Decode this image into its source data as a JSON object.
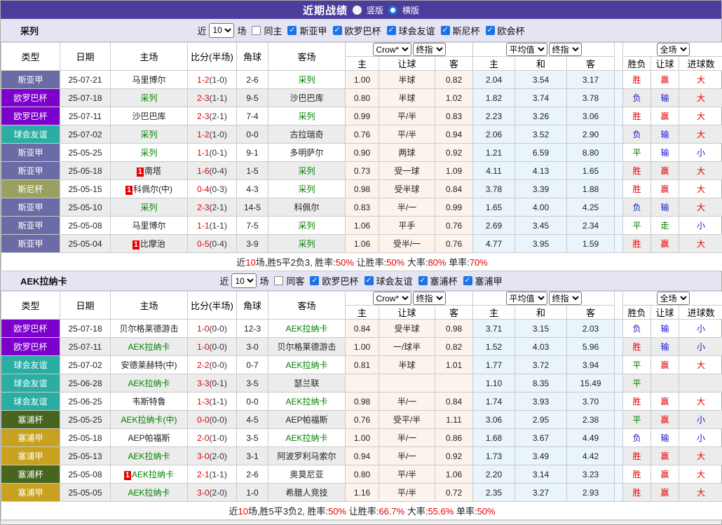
{
  "title_bar": {
    "title": "近期战绩",
    "vertical_label": "竖版",
    "horizontal_label": "横版",
    "vertical_checked": false,
    "horizontal_checked": true
  },
  "colors": {
    "titlebar_bg": "#4b3d9c",
    "filterbar_bg": "#e4e4f3",
    "score_red": "#e60000",
    "focus_team_green": "#008000",
    "league_colors": {
      "斯亚甲": "#6b6ba5",
      "欧罗巴杯": "#7d00cc",
      "球会友谊": "#2aada3",
      "斯尼杯": "#9aa05e",
      "塞浦杯": "#47651d",
      "塞浦甲": "#c7a11f",
      "欧会杯": "#7d00cc"
    },
    "result_class": {
      "胜": "r",
      "赢": "r",
      "大": "r",
      "负": "b",
      "输": "b",
      "小": "b",
      "平": "g",
      "走": "g"
    }
  },
  "tables": [
    {
      "team": "采列",
      "filter": {
        "near_label": "近",
        "count": "10",
        "games_label": "场",
        "same_label": "同主",
        "same_checked": false,
        "leagues": [
          {
            "label": "斯亚甲",
            "checked": true
          },
          {
            "label": "欧罗巴杯",
            "checked": true
          },
          {
            "label": "球会友谊",
            "checked": true
          },
          {
            "label": "斯尼杯",
            "checked": true
          },
          {
            "label": "欧会杯",
            "checked": true
          }
        ]
      },
      "header": {
        "type": "类型",
        "date": "日期",
        "home": "主场",
        "score": "比分(半场)",
        "corner": "角球",
        "away": "客场",
        "odds1_select": "Crow*",
        "odds1_select2": "终指",
        "odds1_cols": [
          "主",
          "让球",
          "客"
        ],
        "odds2_select": "平均值",
        "odds2_select2": "终指",
        "odds2_cols": [
          "主",
          "和",
          "客"
        ],
        "result_select": "全场",
        "result_cols": [
          "胜负",
          "让球",
          "进球数"
        ]
      },
      "rows": [
        {
          "type": "斯亚甲",
          "date": "25-07-21",
          "home": "马里博尔",
          "home_focus": false,
          "home_badge": "",
          "score": "1-2",
          "half": "(1-0)",
          "corner": "2-6",
          "away": "采列",
          "away_focus": true,
          "odds": [
            "1.00",
            "半球",
            "0.82"
          ],
          "avg": [
            "2.04",
            "3.54",
            "3.17"
          ],
          "results": [
            "胜",
            "赢",
            "大"
          ]
        },
        {
          "type": "欧罗巴杯",
          "date": "25-07-18",
          "home": "采列",
          "home_focus": true,
          "home_badge": "",
          "score": "2-3",
          "half": "(1-1)",
          "corner": "9-5",
          "away": "沙巴巴库",
          "away_focus": false,
          "odds": [
            "0.80",
            "半球",
            "1.02"
          ],
          "avg": [
            "1.82",
            "3.74",
            "3.78"
          ],
          "results": [
            "负",
            "输",
            "大"
          ]
        },
        {
          "type": "欧罗巴杯",
          "date": "25-07-11",
          "home": "沙巴巴库",
          "home_focus": false,
          "home_badge": "",
          "score": "2-3",
          "half": "(2-1)",
          "corner": "7-4",
          "away": "采列",
          "away_focus": true,
          "odds": [
            "0.99",
            "平/半",
            "0.83"
          ],
          "avg": [
            "2.23",
            "3.26",
            "3.06"
          ],
          "results": [
            "胜",
            "赢",
            "大"
          ]
        },
        {
          "type": "球会友谊",
          "date": "25-07-02",
          "home": "采列",
          "home_focus": true,
          "home_badge": "",
          "score": "1-2",
          "half": "(1-0)",
          "corner": "0-0",
          "away": "古拉瑞奇",
          "away_focus": false,
          "odds": [
            "0.76",
            "平/半",
            "0.94"
          ],
          "avg": [
            "2.06",
            "3.52",
            "2.90"
          ],
          "results": [
            "负",
            "输",
            "大"
          ]
        },
        {
          "type": "斯亚甲",
          "date": "25-05-25",
          "home": "采列",
          "home_focus": true,
          "home_badge": "",
          "score": "1-1",
          "half": "(0-1)",
          "corner": "9-1",
          "away": "多明萨尔",
          "away_focus": false,
          "odds": [
            "0.90",
            "两球",
            "0.92"
          ],
          "avg": [
            "1.21",
            "6.59",
            "8.80"
          ],
          "results": [
            "平",
            "输",
            "小"
          ]
        },
        {
          "type": "斯亚甲",
          "date": "25-05-18",
          "home": "南塔",
          "home_focus": false,
          "home_badge": "1",
          "score": "1-6",
          "half": "(0-4)",
          "corner": "1-5",
          "away": "采列",
          "away_focus": true,
          "odds": [
            "0.73",
            "受一球",
            "1.09"
          ],
          "avg": [
            "4.11",
            "4.13",
            "1.65"
          ],
          "results": [
            "胜",
            "赢",
            "大"
          ]
        },
        {
          "type": "斯尼杯",
          "date": "25-05-15",
          "home": "科佩尔(中)",
          "home_focus": false,
          "home_badge": "1",
          "score": "0-4",
          "half": "(0-3)",
          "corner": "4-3",
          "away": "采列",
          "away_focus": true,
          "odds": [
            "0.98",
            "受半球",
            "0.84"
          ],
          "avg": [
            "3.78",
            "3.39",
            "1.88"
          ],
          "results": [
            "胜",
            "赢",
            "大"
          ]
        },
        {
          "type": "斯亚甲",
          "date": "25-05-10",
          "home": "采列",
          "home_focus": true,
          "home_badge": "",
          "score": "2-3",
          "half": "(2-1)",
          "corner": "14-5",
          "away": "科佩尔",
          "away_focus": false,
          "odds": [
            "0.83",
            "半/一",
            "0.99"
          ],
          "avg": [
            "1.65",
            "4.00",
            "4.25"
          ],
          "results": [
            "负",
            "输",
            "大"
          ]
        },
        {
          "type": "斯亚甲",
          "date": "25-05-08",
          "home": "马里博尔",
          "home_focus": false,
          "home_badge": "",
          "score": "1-1",
          "half": "(1-1)",
          "corner": "7-5",
          "away": "采列",
          "away_focus": true,
          "odds": [
            "1.06",
            "平手",
            "0.76"
          ],
          "avg": [
            "2.69",
            "3.45",
            "2.34"
          ],
          "results": [
            "平",
            "走",
            "小"
          ]
        },
        {
          "type": "斯亚甲",
          "date": "25-05-04",
          "home": "比摩治",
          "home_focus": false,
          "home_badge": "1",
          "score": "0-5",
          "half": "(0-4)",
          "corner": "3-9",
          "away": "采列",
          "away_focus": true,
          "odds": [
            "1.06",
            "受半/一",
            "0.76"
          ],
          "avg": [
            "4.77",
            "3.95",
            "1.59"
          ],
          "results": [
            "胜",
            "赢",
            "大"
          ]
        }
      ],
      "summary": [
        {
          "text": "近",
          "red": false
        },
        {
          "text": "10",
          "red": true
        },
        {
          "text": "场,胜5平2负3, 胜率:",
          "red": false
        },
        {
          "text": "50%",
          "red": true
        },
        {
          "text": " 让胜率:",
          "red": false
        },
        {
          "text": "50%",
          "red": true
        },
        {
          "text": " 大率:",
          "red": false
        },
        {
          "text": "80%",
          "red": true
        },
        {
          "text": " 单率:",
          "red": false
        },
        {
          "text": "70%",
          "red": true
        }
      ]
    },
    {
      "team": "AEK拉纳卡",
      "filter": {
        "near_label": "近",
        "count": "10",
        "games_label": "场",
        "same_label": "同客",
        "same_checked": false,
        "leagues": [
          {
            "label": "欧罗巴杯",
            "checked": true
          },
          {
            "label": "球会友谊",
            "checked": true
          },
          {
            "label": "塞浦杯",
            "checked": true
          },
          {
            "label": "塞浦甲",
            "checked": true
          }
        ]
      },
      "header": {
        "type": "类型",
        "date": "日期",
        "home": "主场",
        "score": "比分(半场)",
        "corner": "角球",
        "away": "客场",
        "odds1_select": "Crow*",
        "odds1_select2": "终指",
        "odds1_cols": [
          "主",
          "让球",
          "客"
        ],
        "odds2_select": "平均值",
        "odds2_select2": "终指",
        "odds2_cols": [
          "主",
          "和",
          "客"
        ],
        "result_select": "全场",
        "result_cols": [
          "胜负",
          "让球",
          "进球数"
        ]
      },
      "rows": [
        {
          "type": "欧罗巴杯",
          "date": "25-07-18",
          "home": "贝尔格莱德游击",
          "home_focus": false,
          "home_badge": "",
          "score": "1-0",
          "half": "(0-0)",
          "corner": "12-3",
          "away": "AEK拉纳卡",
          "away_focus": true,
          "odds": [
            "0.84",
            "受半球",
            "0.98"
          ],
          "avg": [
            "3.71",
            "3.15",
            "2.03"
          ],
          "results": [
            "负",
            "输",
            "小"
          ]
        },
        {
          "type": "欧罗巴杯",
          "date": "25-07-11",
          "home": "AEK拉纳卡",
          "home_focus": true,
          "home_badge": "",
          "score": "1-0",
          "half": "(0-0)",
          "corner": "3-0",
          "away": "贝尔格莱德游击",
          "away_focus": false,
          "odds": [
            "1.00",
            "一/球半",
            "0.82"
          ],
          "avg": [
            "1.52",
            "4.03",
            "5.96"
          ],
          "results": [
            "胜",
            "输",
            "小"
          ]
        },
        {
          "type": "球会友谊",
          "date": "25-07-02",
          "home": "安德莱赫特(中)",
          "home_focus": false,
          "home_badge": "",
          "score": "2-2",
          "half": "(0-0)",
          "corner": "0-7",
          "away": "AEK拉纳卡",
          "away_focus": true,
          "odds": [
            "0.81",
            "半球",
            "1.01"
          ],
          "avg": [
            "1.77",
            "3.72",
            "3.94"
          ],
          "results": [
            "平",
            "赢",
            "大"
          ]
        },
        {
          "type": "球会友谊",
          "date": "25-06-28",
          "home": "AEK拉纳卡",
          "home_focus": true,
          "home_badge": "",
          "score": "3-3",
          "half": "(0-1)",
          "corner": "3-5",
          "away": "瑟兰联",
          "away_focus": false,
          "odds": [
            "",
            "",
            ""
          ],
          "avg": [
            "1.10",
            "8.35",
            "15.49"
          ],
          "results": [
            "平",
            "",
            ""
          ]
        },
        {
          "type": "球会友谊",
          "date": "25-06-25",
          "home": "韦斯特鲁",
          "home_focus": false,
          "home_badge": "",
          "score": "1-3",
          "half": "(1-1)",
          "corner": "0-0",
          "away": "AEK拉纳卡",
          "away_focus": true,
          "odds": [
            "0.98",
            "半/一",
            "0.84"
          ],
          "avg": [
            "1.74",
            "3.93",
            "3.70"
          ],
          "results": [
            "胜",
            "赢",
            "大"
          ]
        },
        {
          "type": "塞浦杯",
          "date": "25-05-25",
          "home": "AEK拉纳卡(中)",
          "home_focus": true,
          "home_badge": "",
          "score": "0-0",
          "half": "(0-0)",
          "corner": "4-5",
          "away": "AEP帕福斯",
          "away_focus": false,
          "odds": [
            "0.76",
            "受平/半",
            "1.11"
          ],
          "avg": [
            "3.06",
            "2.95",
            "2.38"
          ],
          "results": [
            "平",
            "赢",
            "小"
          ]
        },
        {
          "type": "塞浦甲",
          "date": "25-05-18",
          "home": "AEP帕福斯",
          "home_focus": false,
          "home_badge": "",
          "score": "2-0",
          "half": "(1-0)",
          "corner": "3-5",
          "away": "AEK拉纳卡",
          "away_focus": true,
          "odds": [
            "1.00",
            "半/一",
            "0.86"
          ],
          "avg": [
            "1.68",
            "3.67",
            "4.49"
          ],
          "results": [
            "负",
            "输",
            "小"
          ]
        },
        {
          "type": "塞浦甲",
          "date": "25-05-13",
          "home": "AEK拉纳卡",
          "home_focus": true,
          "home_badge": "",
          "score": "3-0",
          "half": "(2-0)",
          "corner": "3-1",
          "away": "阿波罗利马索尔",
          "away_focus": false,
          "odds": [
            "0.94",
            "半/一",
            "0.92"
          ],
          "avg": [
            "1.73",
            "3.49",
            "4.42"
          ],
          "results": [
            "胜",
            "赢",
            "大"
          ]
        },
        {
          "type": "塞浦杯",
          "date": "25-05-08",
          "home": "AEK拉纳卡",
          "home_focus": true,
          "home_badge": "1",
          "score": "2-1",
          "half": "(1-1)",
          "corner": "2-6",
          "away": "奥莫尼亚",
          "away_focus": false,
          "odds": [
            "0.80",
            "平/半",
            "1.06"
          ],
          "avg": [
            "2.20",
            "3.14",
            "3.23"
          ],
          "results": [
            "胜",
            "赢",
            "大"
          ]
        },
        {
          "type": "塞浦甲",
          "date": "25-05-05",
          "home": "AEK拉纳卡",
          "home_focus": true,
          "home_badge": "",
          "score": "3-0",
          "half": "(2-0)",
          "corner": "1-0",
          "away": "希腊人竞技",
          "away_focus": false,
          "odds": [
            "1.16",
            "平/半",
            "0.72"
          ],
          "avg": [
            "2.35",
            "3.27",
            "2.93"
          ],
          "results": [
            "胜",
            "赢",
            "大"
          ]
        }
      ],
      "summary": [
        {
          "text": "近",
          "red": false
        },
        {
          "text": "10",
          "red": true
        },
        {
          "text": "场,胜5平3负2, 胜率:",
          "red": false
        },
        {
          "text": "50%",
          "red": true
        },
        {
          "text": " 让胜率:",
          "red": false
        },
        {
          "text": "66.7%",
          "red": true
        },
        {
          "text": " 大率:",
          "red": false
        },
        {
          "text": "55.6%",
          "red": true
        },
        {
          "text": " 单率:",
          "red": false
        },
        {
          "text": "50%",
          "red": true
        }
      ]
    }
  ]
}
